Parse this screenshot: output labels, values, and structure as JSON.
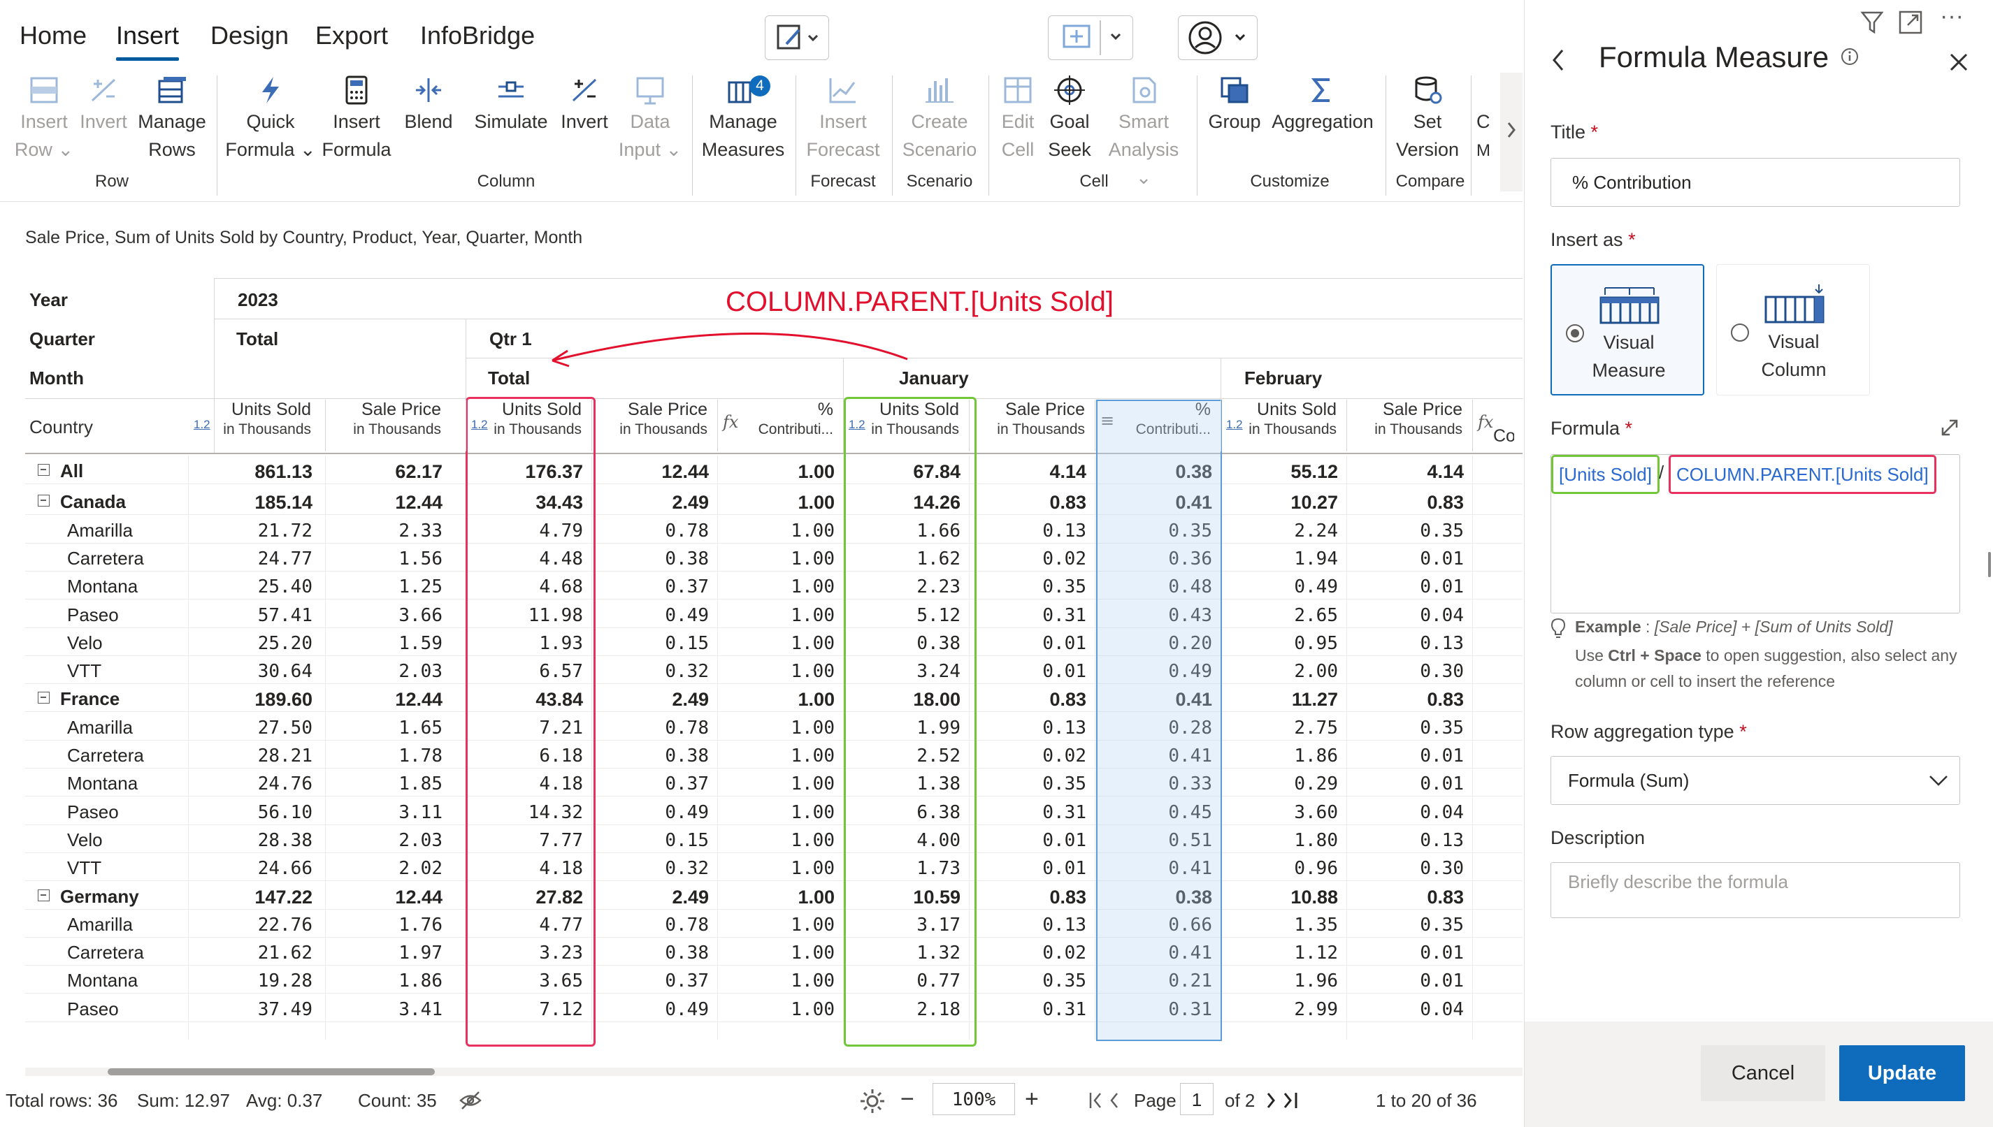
{
  "ribbon": {
    "tabs": [
      "Home",
      "Insert",
      "Design",
      "Export",
      "InfoBridge"
    ],
    "active_tab": "Insert",
    "buttons": {
      "insert_row": [
        "Insert",
        "Row"
      ],
      "invert_row": [
        "Invert",
        ""
      ],
      "manage_rows": [
        "Manage",
        "Rows"
      ],
      "quick_formula": [
        "Quick",
        "Formula"
      ],
      "insert_formula": [
        "Insert",
        "Formula"
      ],
      "blend": [
        "Blend",
        ""
      ],
      "simulate": [
        "Simulate",
        ""
      ],
      "invert_col": [
        "Invert",
        ""
      ],
      "data_input": [
        "Data",
        "Input"
      ],
      "manage_measures": [
        "Manage",
        "Measures"
      ],
      "manage_measures_badge": "4",
      "insert_forecast": [
        "Insert",
        "Forecast"
      ],
      "create_scenario": [
        "Create",
        "Scenario"
      ],
      "edit_cell": [
        "Edit",
        "Cell"
      ],
      "goal_seek": [
        "Goal",
        "Seek"
      ],
      "smart_analysis": [
        "Smart",
        "Analysis"
      ],
      "group": [
        "Group",
        ""
      ],
      "aggregation": [
        "Aggregation",
        ""
      ],
      "set_version": [
        "Set",
        "Version"
      ],
      "clipped": [
        "C",
        "M"
      ]
    },
    "groups": [
      "Row",
      "Column",
      "Forecast",
      "Scenario",
      "Cell",
      "Customize",
      "Compare"
    ]
  },
  "report": {
    "subtitle": "Sale Price, Sum of Units Sold by Country, Product, Year, Quarter, Month",
    "annotation": "COLUMN.PARENT.[Units Sold]",
    "header_labels": {
      "year": "Year",
      "quarter": "Quarter",
      "month": "Month",
      "country": "Country"
    },
    "year_value": "2023",
    "quarter_total": "Total",
    "qtr1": "Qtr 1",
    "month_total": "Total",
    "january": "January",
    "february": "February",
    "columns": [
      {
        "title": "Units Sold",
        "sub": "in Thousands",
        "tag": "1.2"
      },
      {
        "title": "Sale Price",
        "sub": "in Thousands",
        "tag": ""
      },
      {
        "title": "Units Sold",
        "sub": "in Thousands",
        "tag": "1.2"
      },
      {
        "title": "Sale Price",
        "sub": "in Thousands",
        "tag": ""
      },
      {
        "title": "%",
        "sub": "Contributi...",
        "tag": "fx"
      },
      {
        "title": "Units Sold",
        "sub": "in Thousands",
        "tag": "1.2"
      },
      {
        "title": "Sale Price",
        "sub": "in Thousands",
        "tag": ""
      },
      {
        "title": "%",
        "sub": "Contributi...",
        "tag": "menu"
      },
      {
        "title": "Units Sold",
        "sub": "in Thousands",
        "tag": "1.2"
      },
      {
        "title": "Sale Price",
        "sub": "in Thousands",
        "tag": ""
      },
      {
        "title": "Con",
        "sub": "",
        "tag": "fx"
      }
    ],
    "rows": [
      {
        "label": "All",
        "group": true,
        "values": [
          "861.13",
          "62.17",
          "176.37",
          "12.44",
          "1.00",
          "67.84",
          "4.14",
          "0.38",
          "55.12",
          "4.14"
        ]
      },
      {
        "label": "Canada",
        "group": true,
        "values": [
          "185.14",
          "12.44",
          "34.43",
          "2.49",
          "1.00",
          "14.26",
          "0.83",
          "0.41",
          "10.27",
          "0.83"
        ]
      },
      {
        "label": "Amarilla",
        "group": false,
        "values": [
          "21.72",
          "2.33",
          "4.79",
          "0.78",
          "1.00",
          "1.66",
          "0.13",
          "0.35",
          "2.24",
          "0.35"
        ]
      },
      {
        "label": "Carretera",
        "group": false,
        "values": [
          "24.77",
          "1.56",
          "4.48",
          "0.38",
          "1.00",
          "1.62",
          "0.02",
          "0.36",
          "1.94",
          "0.01"
        ]
      },
      {
        "label": "Montana",
        "group": false,
        "values": [
          "25.40",
          "1.25",
          "4.68",
          "0.37",
          "1.00",
          "2.23",
          "0.35",
          "0.48",
          "0.49",
          "0.01"
        ]
      },
      {
        "label": "Paseo",
        "group": false,
        "values": [
          "57.41",
          "3.66",
          "11.98",
          "0.49",
          "1.00",
          "5.12",
          "0.31",
          "0.43",
          "2.65",
          "0.04"
        ]
      },
      {
        "label": "Velo",
        "group": false,
        "values": [
          "25.20",
          "1.59",
          "1.93",
          "0.15",
          "1.00",
          "0.38",
          "0.01",
          "0.20",
          "0.95",
          "0.13"
        ]
      },
      {
        "label": "VTT",
        "group": false,
        "values": [
          "30.64",
          "2.03",
          "6.57",
          "0.32",
          "1.00",
          "3.24",
          "0.01",
          "0.49",
          "2.00",
          "0.30"
        ]
      },
      {
        "label": "France",
        "group": true,
        "values": [
          "189.60",
          "12.44",
          "43.84",
          "2.49",
          "1.00",
          "18.00",
          "0.83",
          "0.41",
          "11.27",
          "0.83"
        ]
      },
      {
        "label": "Amarilla",
        "group": false,
        "values": [
          "27.50",
          "1.65",
          "7.21",
          "0.78",
          "1.00",
          "1.99",
          "0.13",
          "0.28",
          "2.75",
          "0.35"
        ]
      },
      {
        "label": "Carretera",
        "group": false,
        "values": [
          "28.21",
          "1.78",
          "6.18",
          "0.38",
          "1.00",
          "2.52",
          "0.02",
          "0.41",
          "1.86",
          "0.01"
        ]
      },
      {
        "label": "Montana",
        "group": false,
        "values": [
          "24.76",
          "1.85",
          "4.18",
          "0.37",
          "1.00",
          "1.38",
          "0.35",
          "0.33",
          "0.29",
          "0.01"
        ]
      },
      {
        "label": "Paseo",
        "group": false,
        "values": [
          "56.10",
          "3.11",
          "14.32",
          "0.49",
          "1.00",
          "6.38",
          "0.31",
          "0.45",
          "3.60",
          "0.04"
        ]
      },
      {
        "label": "Velo",
        "group": false,
        "values": [
          "28.38",
          "2.03",
          "7.77",
          "0.15",
          "1.00",
          "4.00",
          "0.01",
          "0.51",
          "1.80",
          "0.13"
        ]
      },
      {
        "label": "VTT",
        "group": false,
        "values": [
          "24.66",
          "2.02",
          "4.18",
          "0.32",
          "1.00",
          "1.73",
          "0.01",
          "0.41",
          "0.96",
          "0.30"
        ]
      },
      {
        "label": "Germany",
        "group": true,
        "values": [
          "147.22",
          "12.44",
          "27.82",
          "2.49",
          "1.00",
          "10.59",
          "0.83",
          "0.38",
          "10.88",
          "0.83"
        ]
      },
      {
        "label": "Amarilla",
        "group": false,
        "values": [
          "22.76",
          "1.76",
          "4.77",
          "0.78",
          "1.00",
          "3.17",
          "0.13",
          "0.66",
          "1.35",
          "0.35"
        ]
      },
      {
        "label": "Carretera",
        "group": false,
        "values": [
          "21.62",
          "1.97",
          "3.23",
          "0.38",
          "1.00",
          "1.32",
          "0.02",
          "0.41",
          "1.12",
          "0.01"
        ]
      },
      {
        "label": "Montana",
        "group": false,
        "values": [
          "19.28",
          "1.86",
          "3.65",
          "0.37",
          "1.00",
          "0.77",
          "0.35",
          "0.21",
          "1.96",
          "0.01"
        ]
      },
      {
        "label": "Paseo",
        "group": false,
        "values": [
          "37.49",
          "3.41",
          "7.12",
          "0.49",
          "1.00",
          "2.18",
          "0.31",
          "0.31",
          "2.99",
          "0.04"
        ]
      }
    ]
  },
  "status": {
    "total_rows": "Total rows: 36",
    "sum": "Sum: 12.97",
    "avg": "Avg: 0.37",
    "count": "Count: 35",
    "zoom": "100%",
    "page_label": "Page",
    "page_value": "1",
    "page_of": "of 2",
    "range": "1 to 20 of 36"
  },
  "panel": {
    "title": "Formula Measure",
    "title_label": "Title",
    "title_value": "% Contribution",
    "insert_as_label": "Insert as",
    "opt_visual_measure": [
      "Visual",
      "Measure"
    ],
    "opt_visual_column": [
      "Visual",
      "Column"
    ],
    "formula_label": "Formula",
    "formula_token1": "[Units Sold]",
    "formula_op": "/",
    "formula_token2": "COLUMN.PARENT.[Units Sold]",
    "example_label": "Example",
    "example_text": "[Sale Price] + [Sum of Units Sold]",
    "hint_1": "Use",
    "hint_key": "Ctrl + Space",
    "hint_2": "to open suggestion, also select any",
    "hint_3": "column or cell to insert the reference",
    "row_agg_label": "Row aggregation type",
    "row_agg_value": "Formula (Sum)",
    "description_label": "Description",
    "description_placeholder": "Briefly describe the formula",
    "cancel": "Cancel",
    "update": "Update"
  },
  "colors": {
    "accent": "#0f6cbd",
    "annotation_red": "#e3102d",
    "highlight_green": "#72c63a",
    "highlight_pink": "#e8315e"
  }
}
